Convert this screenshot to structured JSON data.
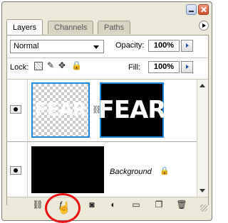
{
  "panel": {
    "tabs": [
      "Layers",
      "Channels",
      "Paths"
    ],
    "blend_mode": "Normal",
    "opacity_label": "Opacity:",
    "opacity_value": "100%",
    "lock_label": "Lock:",
    "fill_label": "Fill:",
    "fill_value": "100%"
  },
  "layers": [
    {
      "thumbnail_text": "FEAR",
      "mask_text": "FEAR"
    },
    {
      "name": "Background"
    }
  ],
  "colors": {
    "highlight": "#1e88e5",
    "annotation_circle": "#ee1111"
  },
  "icons": [
    "link-layers-icon",
    "add-layer-style-icon",
    "add-layer-mask-icon",
    "adjustment-layer-icon",
    "new-group-icon",
    "new-layer-icon",
    "delete-layer-icon"
  ]
}
